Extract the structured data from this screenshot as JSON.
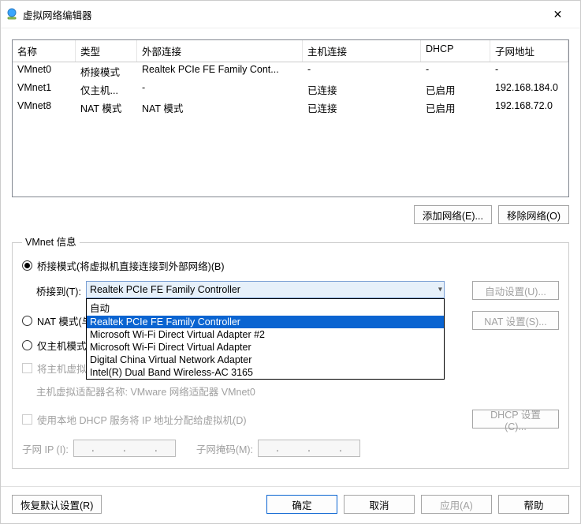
{
  "window": {
    "title": "虚拟网络编辑器",
    "close_symbol": "✕"
  },
  "table": {
    "headers": {
      "name": "名称",
      "type": "类型",
      "external": "外部连接",
      "host": "主机连接",
      "dhcp": "DHCP",
      "subnet": "子网地址"
    },
    "rows": [
      {
        "name": "VMnet0",
        "type": "桥接模式",
        "external": "Realtek PCIe FE Family Cont...",
        "host": "-",
        "dhcp": "-",
        "subnet": "-"
      },
      {
        "name": "VMnet1",
        "type": "仅主机...",
        "external": "-",
        "host": "已连接",
        "dhcp": "已启用",
        "subnet": "192.168.184.0"
      },
      {
        "name": "VMnet8",
        "type": "NAT 模式",
        "external": "NAT 模式",
        "host": "已连接",
        "dhcp": "已启用",
        "subnet": "192.168.72.0"
      }
    ]
  },
  "buttons": {
    "add_network": "添加网络(E)...",
    "remove_network": "移除网络(O)",
    "auto_settings": "自动设置(U)...",
    "nat_settings": "NAT 设置(S)...",
    "dhcp_settings": "DHCP 设置(C)...",
    "restore_defaults": "恢复默认设置(R)",
    "ok": "确定",
    "cancel": "取消",
    "apply": "应用(A)",
    "help": "帮助"
  },
  "fieldset": {
    "legend": "VMnet 信息",
    "radio_bridge": "桥接模式(将虚拟机直接连接到外部网络)(B)",
    "bridge_to_label": "桥接到(T):",
    "radio_nat": "NAT 模式(与",
    "radio_hostonly": "仅主机模式",
    "chk_connect_host": "将主机虚拟",
    "host_adapter_label": "主机虚拟适配器名称: VMware 网络适配器 VMnet0",
    "chk_dhcp": "使用本地 DHCP 服务将 IP 地址分配给虚拟机(D)",
    "subnet_ip_label": "子网 IP (I):",
    "subnet_mask_label": "子网掩码(M):"
  },
  "combo": {
    "selected": "Realtek PCIe FE Family Controller",
    "options": [
      "自动",
      "Realtek PCIe FE Family Controller",
      "Microsoft Wi-Fi Direct Virtual Adapter #2",
      "Microsoft Wi-Fi Direct Virtual Adapter",
      "Digital China Virtual Network Adapter",
      "Intel(R) Dual Band Wireless-AC 3165"
    ],
    "selected_index": 1
  },
  "ip_placeholder_dots": ". . ."
}
